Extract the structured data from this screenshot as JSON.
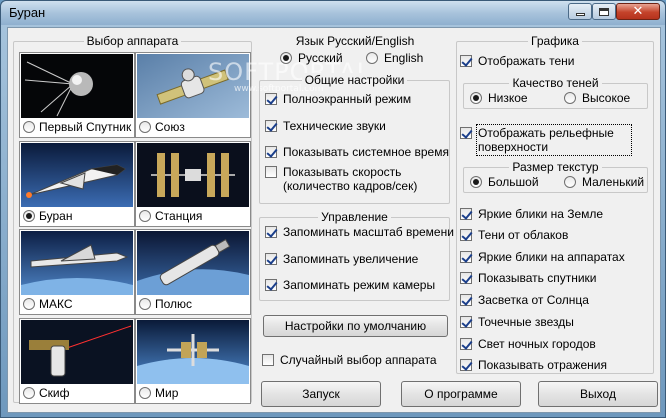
{
  "window": {
    "title": "Буран"
  },
  "vehicle_group": {
    "title": "Выбор аппарата",
    "items": [
      {
        "label": "Первый Спутник",
        "selected": false
      },
      {
        "label": "Союз",
        "selected": false
      },
      {
        "label": "Буран",
        "selected": true
      },
      {
        "label": "Станция",
        "selected": false
      },
      {
        "label": "МАКС",
        "selected": false
      },
      {
        "label": "Полюс",
        "selected": false
      },
      {
        "label": "Скиф",
        "selected": false
      },
      {
        "label": "Мир",
        "selected": false
      }
    ],
    "watermark": "SOFTPORTAL",
    "watermark_url": "www.softportal.com"
  },
  "language": {
    "title": "Язык  Русский/English",
    "options": [
      {
        "label": "Русский",
        "selected": true
      },
      {
        "label": "English",
        "selected": false
      }
    ]
  },
  "general": {
    "title": "Общие настройки",
    "items": [
      {
        "label": "Полноэкранный режим",
        "checked": true
      },
      {
        "label": "Технические звуки",
        "checked": true
      },
      {
        "label": "Показывать системное время",
        "checked": true
      },
      {
        "label": "Показывать скорость (количество кадров/сек)",
        "checked": false
      }
    ]
  },
  "control": {
    "title": "Управление",
    "items": [
      {
        "label": "Запоминать масштаб времени",
        "checked": true
      },
      {
        "label": "Запоминать увеличение",
        "checked": true
      },
      {
        "label": "Запоминать режим камеры",
        "checked": true
      }
    ]
  },
  "defaults_button": "Настройки по умолчанию",
  "random_choice": {
    "label": "Случайный выбор аппарата",
    "checked": false
  },
  "graphics": {
    "title": "Графика",
    "show_shadows": {
      "label": "Отображать тени",
      "checked": true
    },
    "shadow_quality": {
      "title": "Качество теней",
      "options": [
        {
          "label": "Низкое",
          "selected": true
        },
        {
          "label": "Высокое",
          "selected": false
        }
      ]
    },
    "relief": {
      "label": "Отображать рельефные поверхности",
      "checked": true
    },
    "texture_size": {
      "title": "Размер текстур",
      "options": [
        {
          "label": "Большой",
          "selected": true
        },
        {
          "label": "Маленький",
          "selected": false
        }
      ]
    },
    "items": [
      {
        "label": "Яркие блики на Земле",
        "checked": true
      },
      {
        "label": "Тени от облаков",
        "checked": true
      },
      {
        "label": "Яркие блики на аппаратах",
        "checked": true
      },
      {
        "label": "Показывать спутники",
        "checked": true
      },
      {
        "label": "Засветка от Солнца",
        "checked": true
      },
      {
        "label": "Точечные звезды",
        "checked": true
      },
      {
        "label": "Свет ночных городов",
        "checked": true
      },
      {
        "label": "Показывать отражения",
        "checked": true
      }
    ]
  },
  "buttons": {
    "start": "Запуск",
    "about": "О программе",
    "exit": "Выход"
  }
}
